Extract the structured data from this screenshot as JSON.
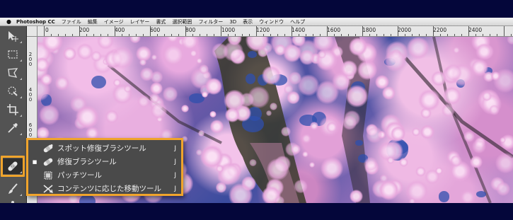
{
  "menubar": {
    "app_name": "Photoshop CC",
    "items": [
      "ファイル",
      "編集",
      "イメージ",
      "レイヤー",
      "書式",
      "選択範囲",
      "フィルター",
      "3D",
      "表示",
      "ウィンドウ",
      "ヘルプ"
    ]
  },
  "ruler": {
    "top_labels": [
      "0",
      "200",
      "400",
      "600",
      "800",
      "1000",
      "1200",
      "1400",
      "1600",
      "1800",
      "2000",
      "2200",
      "2400"
    ],
    "left_labels": [
      "2\n0\n0",
      "4\n0\n0",
      "6\n0\n0"
    ]
  },
  "tools": [
    {
      "name": "move-tool",
      "icon": "move-icon"
    },
    {
      "name": "marquee-tool",
      "icon": "rect-marquee-icon"
    },
    {
      "name": "lasso-tool",
      "icon": "polygon-lasso-icon"
    },
    {
      "name": "quick-selection-tool",
      "icon": "quick-selection-icon"
    },
    {
      "name": "crop-tool",
      "icon": "crop-icon"
    },
    {
      "name": "eyedropper-tool",
      "icon": "eyedropper-icon"
    },
    {
      "name": "healing-brush-tool",
      "icon": "bandage-icon"
    },
    {
      "name": "brush-tool",
      "icon": "brush-icon"
    },
    {
      "name": "clone-stamp-tool",
      "icon": "stamp-icon"
    }
  ],
  "flyout": {
    "items": [
      {
        "label": "スポット修復ブラシツール",
        "shortcut": "J",
        "selected": false,
        "icon": "spot-healing-icon"
      },
      {
        "label": "修復ブラシツール",
        "shortcut": "J",
        "selected": true,
        "icon": "healing-brush-icon"
      },
      {
        "label": "パッチツール",
        "shortcut": "J",
        "selected": false,
        "icon": "patch-icon"
      },
      {
        "label": "コンテンツに応じた移動ツール",
        "shortcut": "J",
        "selected": false,
        "icon": "content-aware-move-icon"
      }
    ],
    "selected_marker": "■"
  },
  "colors": {
    "highlight": "#f0a42c",
    "border_background": "#04063a",
    "panel": "#535353"
  }
}
